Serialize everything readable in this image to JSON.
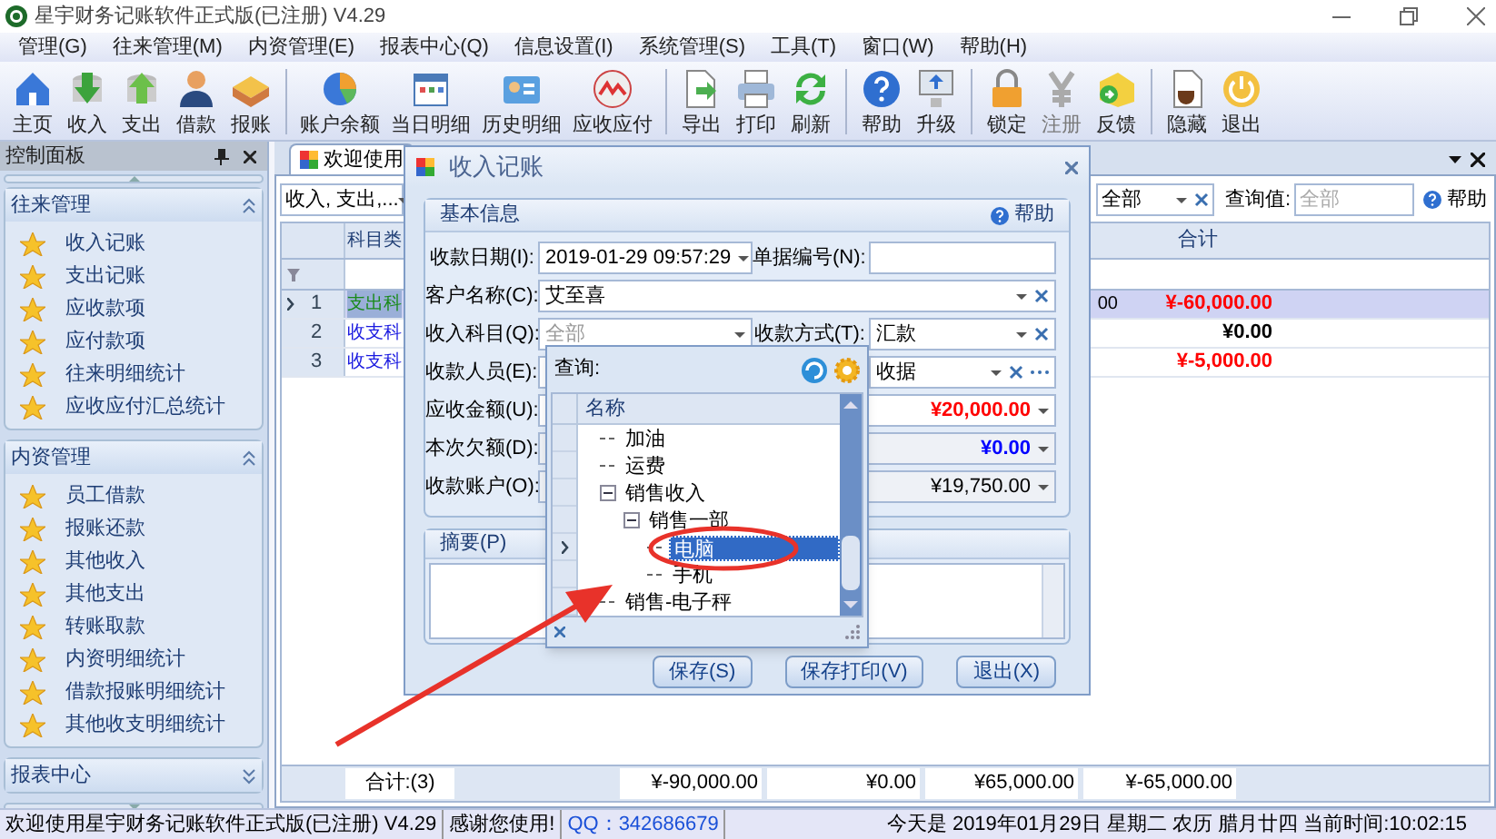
{
  "window": {
    "title": "星宇财务记账软件正式版(已注册) V4.29"
  },
  "menu": [
    "管理(G)",
    "往来管理(M)",
    "内资管理(E)",
    "报表中心(Q)",
    "信息设置(I)",
    "系统管理(S)",
    "工具(T)",
    "窗口(W)",
    "帮助(H)"
  ],
  "toolbar": {
    "groups": [
      {
        "items": [
          {
            "label": "主页",
            "disabled": false
          },
          {
            "label": "收入",
            "disabled": false
          },
          {
            "label": "支出",
            "disabled": false
          },
          {
            "label": "借款",
            "disabled": false
          },
          {
            "label": "报账",
            "disabled": false
          }
        ]
      },
      {
        "items": [
          {
            "label": "账户余额",
            "disabled": false
          },
          {
            "label": "当日明细",
            "disabled": false
          },
          {
            "label": "历史明细",
            "disabled": false
          },
          {
            "label": "应收应付",
            "disabled": false
          }
        ]
      },
      {
        "items": [
          {
            "label": "导出",
            "disabled": false
          },
          {
            "label": "打印",
            "disabled": false
          },
          {
            "label": "刷新",
            "disabled": false
          }
        ]
      },
      {
        "items": [
          {
            "label": "帮助",
            "disabled": false
          },
          {
            "label": "升级",
            "disabled": false
          }
        ]
      },
      {
        "items": [
          {
            "label": "锁定",
            "disabled": false
          },
          {
            "label": "注册",
            "disabled": true
          },
          {
            "label": "反馈",
            "disabled": false
          }
        ]
      },
      {
        "items": [
          {
            "label": "隐藏",
            "disabled": false
          },
          {
            "label": "退出",
            "disabled": false
          }
        ]
      }
    ]
  },
  "control_panel": {
    "title": "控制面板",
    "groups": [
      {
        "title": "往来管理",
        "expanded": true,
        "items": [
          "收入记账",
          "支出记账",
          "应收款项",
          "应付款项",
          "往来明细统计",
          "应收应付汇总统计"
        ]
      },
      {
        "title": "内资管理",
        "expanded": true,
        "items": [
          "员工借款",
          "报账还款",
          "其他收入",
          "其他支出",
          "转账取款",
          "内资明细统计",
          "借款报账明细统计",
          "其他收支明细统计"
        ]
      },
      {
        "title": "报表中心",
        "expanded": false
      }
    ]
  },
  "tabs": [
    {
      "label": "欢迎使用",
      "selected": true
    }
  ],
  "filter_bar": {
    "type_combo": "收入, 支出,...",
    "scope_combo": "全部",
    "query_label": "查询值:",
    "query_placeholder": "全部",
    "help": "帮助"
  },
  "grid": {
    "columns": [
      "科目类",
      "合计"
    ],
    "rows": [
      {
        "index": "1",
        "column_1": "支出科",
        "kind": "expense",
        "column_3": "00",
        "total": "¥-60,000.00",
        "negative": true,
        "selected": true
      },
      {
        "index": "2",
        "column_1": "收支科",
        "kind": "mixed",
        "total": "¥0.00",
        "negative": false,
        "selected": false
      },
      {
        "index": "3",
        "column_1": "收支科",
        "kind": "mixed",
        "total": "¥-5,000.00",
        "negative": true,
        "selected": false
      }
    ],
    "footer": {
      "count": "合计:(3)",
      "totals": [
        "¥-90,000.00",
        "¥0.00",
        "¥65,000.00",
        "¥-65,000.00"
      ]
    }
  },
  "dialog": {
    "title": "收入记账",
    "basic_info": {
      "title": "基本信息",
      "help": "帮助",
      "rows": [
        [
          {
            "label": "收款日期(I):",
            "value": "2019-01-29 09:57:29",
            "kind": "date"
          },
          {
            "label": "单据编号(N):",
            "kind": "text"
          }
        ],
        [
          {
            "label": "客户名称(C):",
            "value": "艾至喜",
            "kind": "combo-clear"
          }
        ],
        [
          {
            "label": "收入科目(Q):",
            "placeholder": "全部",
            "kind": "combo"
          },
          {
            "label": "收款方式(T):",
            "value": "汇款",
            "kind": "combo-clear"
          }
        ],
        [
          {
            "label": "收款人员(E):",
            "kind": "combo"
          },
          {
            "value": "收据",
            "kind": "combo-more"
          }
        ],
        [
          {
            "label": "应收金额(U):",
            "value": "¥20,000.00",
            "kind": "amount",
            "color": "#ff0000",
            "disabled": false
          }
        ],
        [
          {
            "label": "本次欠额(D):",
            "value": "¥0.00",
            "kind": "amount",
            "color": "#0000ff",
            "disabled": true
          }
        ],
        [
          {
            "label": "收款账户(O):",
            "value": "¥19,750.00",
            "kind": "amount",
            "color": "#000000",
            "disabled": true
          }
        ]
      ]
    },
    "summary": {
      "label": "摘要(P)"
    },
    "buttons": [
      "保存(S)",
      "保存打印(V)",
      "退出(X)"
    ]
  },
  "query_popup": {
    "query_label": "查询:",
    "column": "名称",
    "tree": [
      {
        "label": "加油",
        "selected": false
      },
      {
        "label": "运费",
        "selected": false
      },
      {
        "label": "销售收入",
        "selected": false,
        "expanded": true,
        "children": [
          {
            "label": "销售一部",
            "selected": false,
            "expanded": true,
            "children": [
              {
                "label": "电脑",
                "selected": true
              },
              {
                "label": "手机",
                "selected": false
              }
            ]
          }
        ]
      },
      {
        "label": "销售-电子秤",
        "selected": false
      }
    ]
  },
  "status_bar": [
    {
      "text": "欢迎使用星宇财务记账软件正式版(已注册) V4.29",
      "kind": "plain"
    },
    {
      "text": "感谢您使用!",
      "kind": "plain"
    },
    {
      "text": "QQ：342686679",
      "kind": "link"
    },
    {
      "text": "今天是 2019年01月29日 星期二 农历 腊月廿四 当前时间:10:02:15",
      "kind": "clock"
    }
  ]
}
